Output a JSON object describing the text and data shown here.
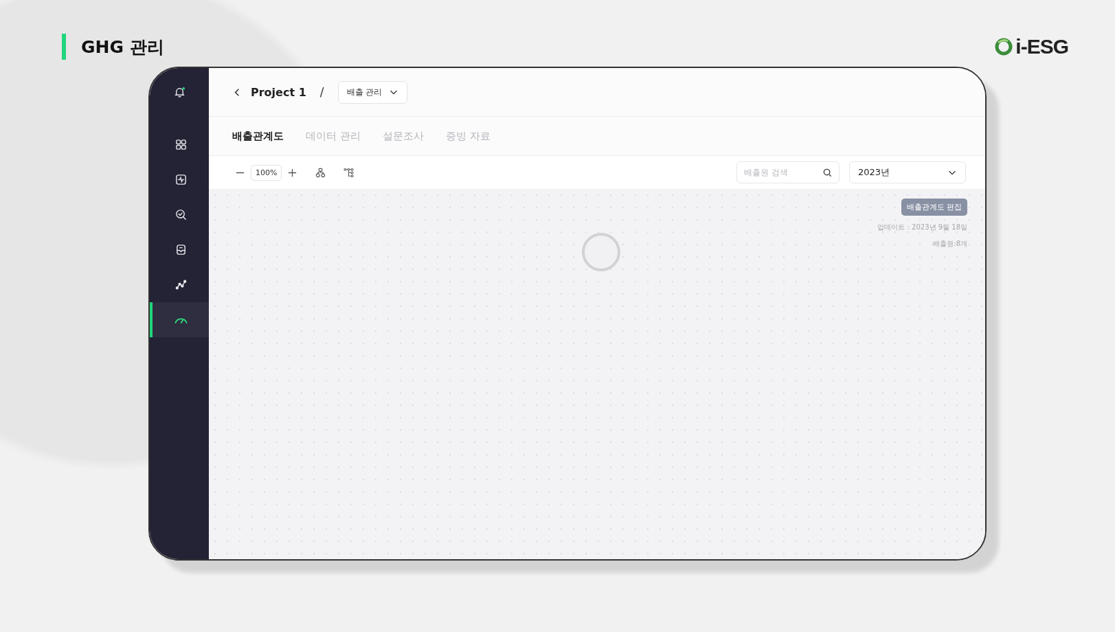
{
  "page_title": "GHG 관리",
  "logo": {
    "text": "i-ESG"
  },
  "sidebar": {
    "bell_unread": true,
    "items": [
      {
        "selected": false
      },
      {
        "selected": false
      },
      {
        "selected": false
      },
      {
        "selected": false
      },
      {
        "selected": false
      },
      {
        "selected": true
      }
    ]
  },
  "breadcrumb": {
    "project": "Project 1",
    "separator": "/",
    "dropdown": "배출 관리"
  },
  "tabs": [
    {
      "label": "배출관계도",
      "selected": true
    },
    {
      "label": "데이터 관리",
      "selected": false
    },
    {
      "label": "설문조사",
      "selected": false
    },
    {
      "label": "증빙 자료",
      "selected": false
    }
  ],
  "toolbar": {
    "zoom": "100%",
    "search": {
      "placeholder": "배출원 검색"
    },
    "year": "2023년"
  },
  "canvas": {
    "edit_button": "배출관계도 편집",
    "updated": "업데이트 : 2023년 9월 18일",
    "source_count": "배출원:8개",
    "loading": true
  }
}
